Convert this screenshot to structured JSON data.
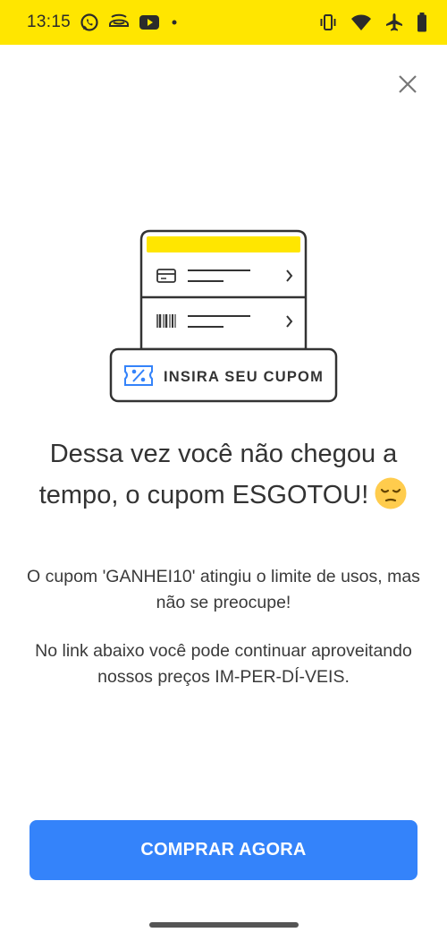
{
  "status_bar": {
    "time": "13:15",
    "background": "#FFE600",
    "left_icons": [
      "whatsapp-icon",
      "notification-app-icon",
      "youtube-icon",
      "more-dot-icon"
    ],
    "right_icons": [
      "vibrate-icon",
      "wifi-icon",
      "airplane-icon",
      "battery-icon"
    ]
  },
  "dialog": {
    "close_icon": "close-icon",
    "illustration": {
      "row_icons": [
        "card-icon",
        "barcode-icon"
      ],
      "coupon_label": "INSIRA SEU CUPOM",
      "coupon_icon": "coupon-percent-icon",
      "accent_color": "#FFE600",
      "icon_color": "#3483FA"
    },
    "headline": "Dessa vez você não chegou a tempo, o cupom ESGOTOU!",
    "headline_emoji": "pensive-face",
    "message_1": "O cupom 'GANHEI10' atingiu o limite de usos, mas não se preocupe!",
    "message_2": "No link abaixo você pode continuar aproveitando nossos preços IM-PER-DÍ-VEIS.",
    "cta_label": "COMPRAR AGORA",
    "cta_color": "#3483FA"
  }
}
